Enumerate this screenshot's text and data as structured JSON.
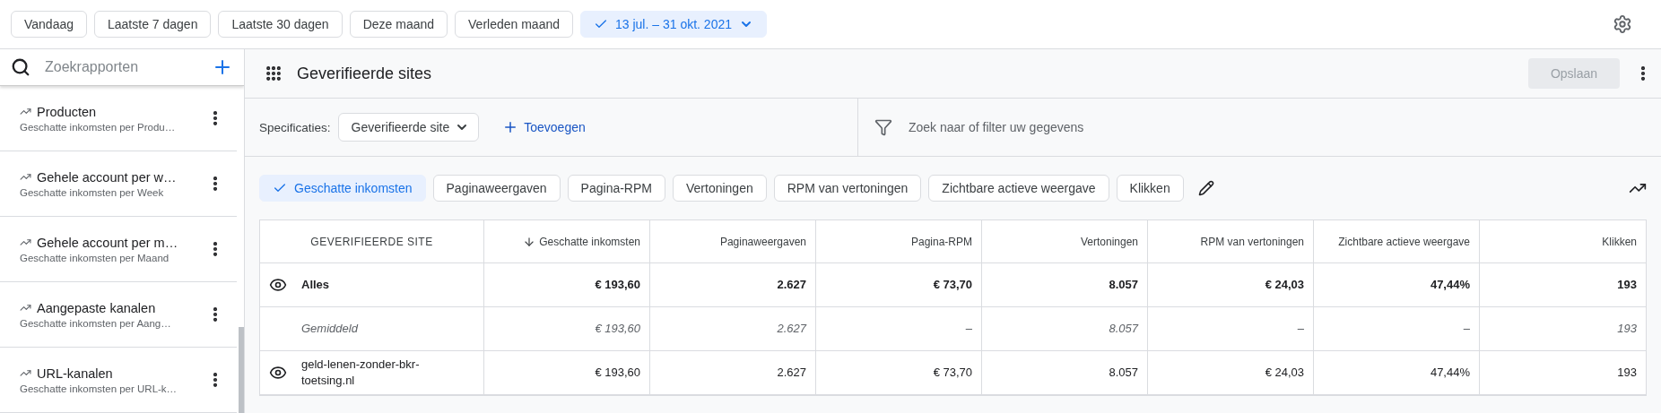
{
  "date_presets": [
    {
      "label": "Vandaag",
      "selected": false
    },
    {
      "label": "Laatste 7 dagen",
      "selected": false
    },
    {
      "label": "Laatste 30 dagen",
      "selected": false
    },
    {
      "label": "Deze maand",
      "selected": false
    },
    {
      "label": "Verleden maand",
      "selected": false
    },
    {
      "label": "13 jul. – 31 okt. 2021",
      "selected": true
    }
  ],
  "sidebar": {
    "search": {
      "placeholder": "Zoekrapporten"
    },
    "items": [
      {
        "title": "Producten",
        "subtitle": "Geschatte inkomsten per Produ…"
      },
      {
        "title": "Gehele account per w…",
        "subtitle": "Geschatte inkomsten per Week"
      },
      {
        "title": "Gehele account per m…",
        "subtitle": "Geschatte inkomsten per Maand"
      },
      {
        "title": "Aangepaste kanalen",
        "subtitle": "Geschatte inkomsten per Aang…"
      },
      {
        "title": "URL-kanalen",
        "subtitle": "Geschatte inkomsten per URL-k…"
      }
    ]
  },
  "report": {
    "title": "Geverifieerde sites",
    "save_button": {
      "label": "Opslaan",
      "disabled": true
    }
  },
  "specifications": {
    "label": "Specificaties:",
    "dimension": "Geverifieerde site",
    "add": "Toevoegen",
    "filter": {
      "placeholder": "Zoek naar of filter uw gegevens"
    }
  },
  "metrics": [
    {
      "label": "Geschatte inkomsten",
      "selected": true
    },
    {
      "label": "Paginaweergaven",
      "selected": false
    },
    {
      "label": "Pagina-RPM",
      "selected": false
    },
    {
      "label": "Vertoningen",
      "selected": false
    },
    {
      "label": "RPM van vertoningen",
      "selected": false
    },
    {
      "label": "Zichtbare actieve weergave",
      "selected": false
    },
    {
      "label": "Klikken",
      "selected": false
    }
  ],
  "table": {
    "columns": [
      {
        "label": "GEVERIFIEERDE SITE",
        "sorted": false
      },
      {
        "label": "Geschatte inkomsten",
        "sorted": true
      },
      {
        "label": "Paginaweergaven",
        "sorted": false
      },
      {
        "label": "Pagina-RPM",
        "sorted": false
      },
      {
        "label": "Vertoningen",
        "sorted": false
      },
      {
        "label": "RPM van vertoningen",
        "sorted": false
      },
      {
        "label": "Zichtbare actieve weergave",
        "sorted": false
      },
      {
        "label": "Klikken",
        "sorted": false
      }
    ],
    "rows": [
      {
        "kind": "total",
        "visible": true,
        "cells": [
          "Alles",
          "€ 193,60",
          "2.627",
          "€ 73,70",
          "8.057",
          "€ 24,03",
          "47,44%",
          "193"
        ]
      },
      {
        "kind": "average",
        "visible": false,
        "cells": [
          "Gemiddeld",
          "€ 193,60",
          "2.627",
          "–",
          "8.057",
          "–",
          "–",
          "193"
        ]
      },
      {
        "kind": "site",
        "visible": true,
        "cells": [
          "geld-lenen-zonder-bkr-toetsing.nl",
          "€ 193,60",
          "2.627",
          "€ 73,70",
          "8.057",
          "€ 24,03",
          "47,44%",
          "193"
        ]
      }
    ]
  }
}
